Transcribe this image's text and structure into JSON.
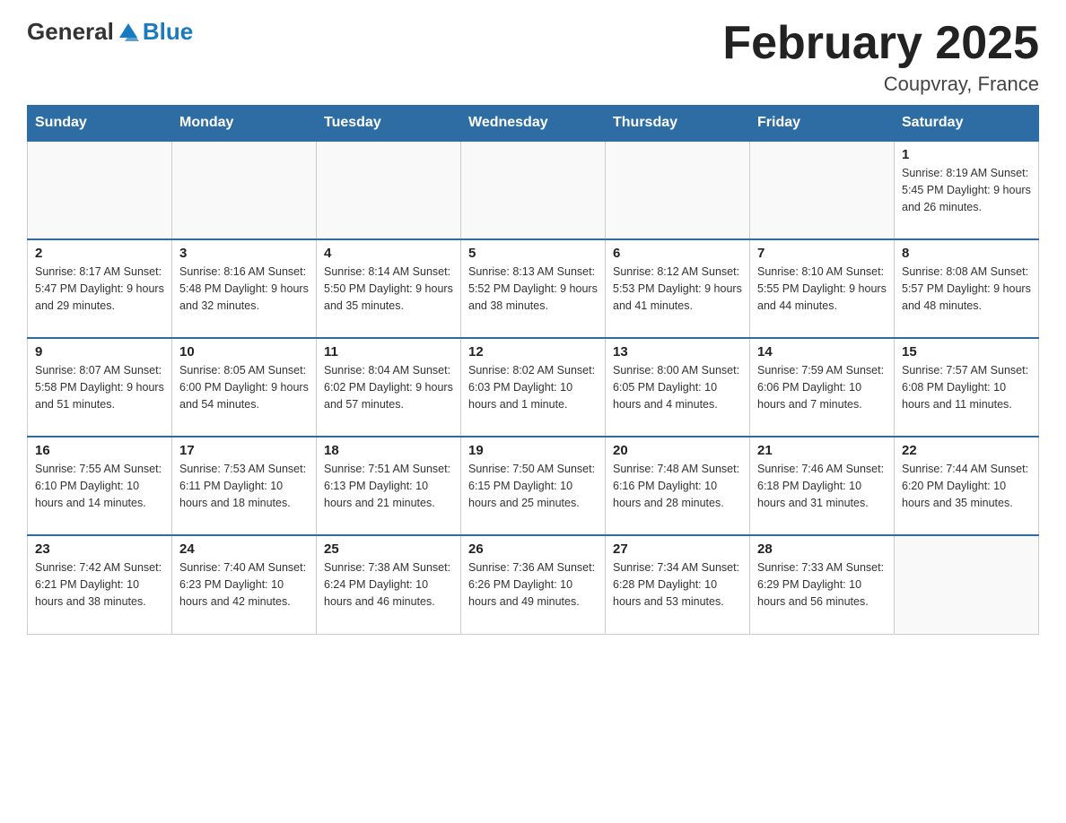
{
  "header": {
    "logo_general": "General",
    "logo_blue": "Blue",
    "title": "February 2025",
    "subtitle": "Coupvray, France"
  },
  "weekdays": [
    "Sunday",
    "Monday",
    "Tuesday",
    "Wednesday",
    "Thursday",
    "Friday",
    "Saturday"
  ],
  "weeks": [
    [
      {
        "day": "",
        "info": ""
      },
      {
        "day": "",
        "info": ""
      },
      {
        "day": "",
        "info": ""
      },
      {
        "day": "",
        "info": ""
      },
      {
        "day": "",
        "info": ""
      },
      {
        "day": "",
        "info": ""
      },
      {
        "day": "1",
        "info": "Sunrise: 8:19 AM\nSunset: 5:45 PM\nDaylight: 9 hours\nand 26 minutes."
      }
    ],
    [
      {
        "day": "2",
        "info": "Sunrise: 8:17 AM\nSunset: 5:47 PM\nDaylight: 9 hours\nand 29 minutes."
      },
      {
        "day": "3",
        "info": "Sunrise: 8:16 AM\nSunset: 5:48 PM\nDaylight: 9 hours\nand 32 minutes."
      },
      {
        "day": "4",
        "info": "Sunrise: 8:14 AM\nSunset: 5:50 PM\nDaylight: 9 hours\nand 35 minutes."
      },
      {
        "day": "5",
        "info": "Sunrise: 8:13 AM\nSunset: 5:52 PM\nDaylight: 9 hours\nand 38 minutes."
      },
      {
        "day": "6",
        "info": "Sunrise: 8:12 AM\nSunset: 5:53 PM\nDaylight: 9 hours\nand 41 minutes."
      },
      {
        "day": "7",
        "info": "Sunrise: 8:10 AM\nSunset: 5:55 PM\nDaylight: 9 hours\nand 44 minutes."
      },
      {
        "day": "8",
        "info": "Sunrise: 8:08 AM\nSunset: 5:57 PM\nDaylight: 9 hours\nand 48 minutes."
      }
    ],
    [
      {
        "day": "9",
        "info": "Sunrise: 8:07 AM\nSunset: 5:58 PM\nDaylight: 9 hours\nand 51 minutes."
      },
      {
        "day": "10",
        "info": "Sunrise: 8:05 AM\nSunset: 6:00 PM\nDaylight: 9 hours\nand 54 minutes."
      },
      {
        "day": "11",
        "info": "Sunrise: 8:04 AM\nSunset: 6:02 PM\nDaylight: 9 hours\nand 57 minutes."
      },
      {
        "day": "12",
        "info": "Sunrise: 8:02 AM\nSunset: 6:03 PM\nDaylight: 10 hours\nand 1 minute."
      },
      {
        "day": "13",
        "info": "Sunrise: 8:00 AM\nSunset: 6:05 PM\nDaylight: 10 hours\nand 4 minutes."
      },
      {
        "day": "14",
        "info": "Sunrise: 7:59 AM\nSunset: 6:06 PM\nDaylight: 10 hours\nand 7 minutes."
      },
      {
        "day": "15",
        "info": "Sunrise: 7:57 AM\nSunset: 6:08 PM\nDaylight: 10 hours\nand 11 minutes."
      }
    ],
    [
      {
        "day": "16",
        "info": "Sunrise: 7:55 AM\nSunset: 6:10 PM\nDaylight: 10 hours\nand 14 minutes."
      },
      {
        "day": "17",
        "info": "Sunrise: 7:53 AM\nSunset: 6:11 PM\nDaylight: 10 hours\nand 18 minutes."
      },
      {
        "day": "18",
        "info": "Sunrise: 7:51 AM\nSunset: 6:13 PM\nDaylight: 10 hours\nand 21 minutes."
      },
      {
        "day": "19",
        "info": "Sunrise: 7:50 AM\nSunset: 6:15 PM\nDaylight: 10 hours\nand 25 minutes."
      },
      {
        "day": "20",
        "info": "Sunrise: 7:48 AM\nSunset: 6:16 PM\nDaylight: 10 hours\nand 28 minutes."
      },
      {
        "day": "21",
        "info": "Sunrise: 7:46 AM\nSunset: 6:18 PM\nDaylight: 10 hours\nand 31 minutes."
      },
      {
        "day": "22",
        "info": "Sunrise: 7:44 AM\nSunset: 6:20 PM\nDaylight: 10 hours\nand 35 minutes."
      }
    ],
    [
      {
        "day": "23",
        "info": "Sunrise: 7:42 AM\nSunset: 6:21 PM\nDaylight: 10 hours\nand 38 minutes."
      },
      {
        "day": "24",
        "info": "Sunrise: 7:40 AM\nSunset: 6:23 PM\nDaylight: 10 hours\nand 42 minutes."
      },
      {
        "day": "25",
        "info": "Sunrise: 7:38 AM\nSunset: 6:24 PM\nDaylight: 10 hours\nand 46 minutes."
      },
      {
        "day": "26",
        "info": "Sunrise: 7:36 AM\nSunset: 6:26 PM\nDaylight: 10 hours\nand 49 minutes."
      },
      {
        "day": "27",
        "info": "Sunrise: 7:34 AM\nSunset: 6:28 PM\nDaylight: 10 hours\nand 53 minutes."
      },
      {
        "day": "28",
        "info": "Sunrise: 7:33 AM\nSunset: 6:29 PM\nDaylight: 10 hours\nand 56 minutes."
      },
      {
        "day": "",
        "info": ""
      }
    ]
  ]
}
